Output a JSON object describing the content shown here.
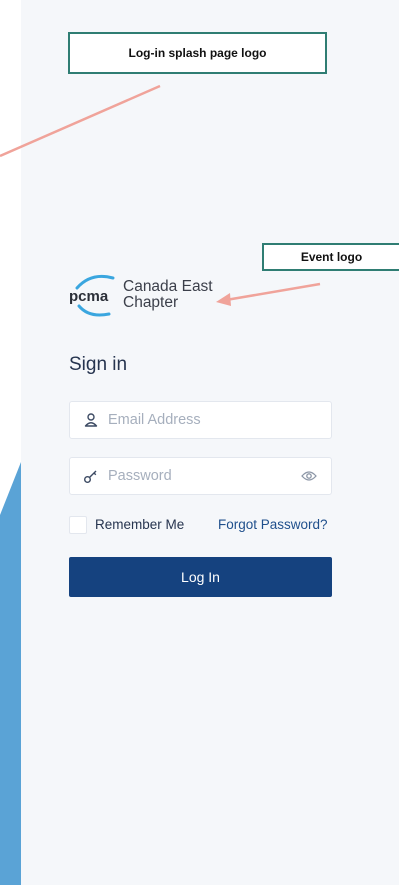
{
  "annotations": {
    "splash_logo": "Log-in splash page logo",
    "event_logo": "Event logo"
  },
  "logo": {
    "mark_text": "pcma",
    "line1": "Canada East",
    "line2": "Chapter"
  },
  "signin": {
    "title": "Sign in",
    "email_placeholder": "Email Address",
    "password_placeholder": "Password",
    "remember_label": "Remember Me",
    "forgot_label": "Forgot Password?",
    "login_label": "Log In"
  },
  "colors": {
    "panel_bg": "#f5f7fa",
    "accent_blue": "#15427f",
    "link_blue": "#1f4f8c",
    "side_shape_blue": "#5aa3d6",
    "annotation_border": "#2f7d73",
    "annotation_arrow": "#f0a39a"
  },
  "icons": {
    "email": "user-icon",
    "password": "key-icon",
    "show_password": "eye-icon"
  }
}
